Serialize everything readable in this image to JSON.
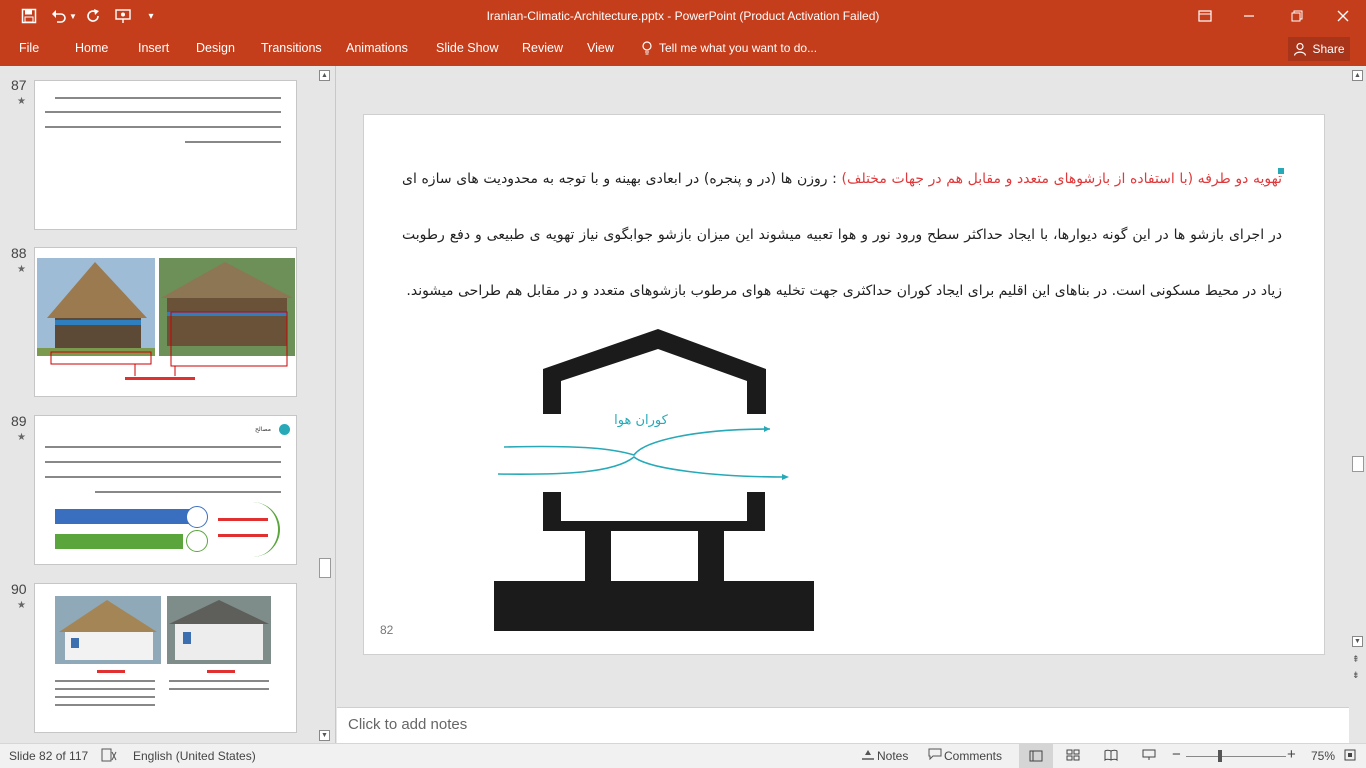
{
  "window": {
    "title": "Iranian-Climatic-Architecture.pptx - PowerPoint (Product Activation Failed)"
  },
  "ribbon": {
    "file": "File",
    "tabs": [
      "Home",
      "Insert",
      "Design",
      "Transitions",
      "Animations",
      "Slide Show",
      "Review",
      "View"
    ],
    "tell_me": "Tell me what you want to do...",
    "share": "Share"
  },
  "thumbnails": [
    {
      "number": "87",
      "caption": ""
    },
    {
      "number": "88",
      "caption": ""
    },
    {
      "number": "89",
      "caption": "مصالح"
    },
    {
      "number": "90",
      "caption": ""
    }
  ],
  "slide": {
    "highlight": "تهویه دو طرفه (با استفاده از بازشوهای متعدد و مقابل هم در جهات مختلف)",
    "body": " : روزن ها (در و پنجره) در ابعادی بهینه و با توجه به محدودیت های سازه ای در اجرای بازشو ها در این گونه دیوارها، با ایجاد حداکثر سطح ورود نور و هوا تعبیه میشوند این میزان بازشو جوابگوی نیاز تهویه ی طبیعی و دفع رطوبت زیاد در محیط مسکونی است. در بناهای این اقلیم برای ایجاد کوران حداکثری جهت تخلیه هوای مرطوب بازشوهای متعدد و در مقابل هم طراحی میشوند.",
    "diagram_label": "کوران هوا",
    "page_number": "82",
    "accent_color": "#27a9b8",
    "highlight_color": "#e0393b"
  },
  "notes": {
    "placeholder": "Click to add notes"
  },
  "status": {
    "slide_info": "Slide 82 of 117",
    "language": "English (United States)",
    "notes": "Notes",
    "comments": "Comments",
    "zoom": "75%"
  }
}
